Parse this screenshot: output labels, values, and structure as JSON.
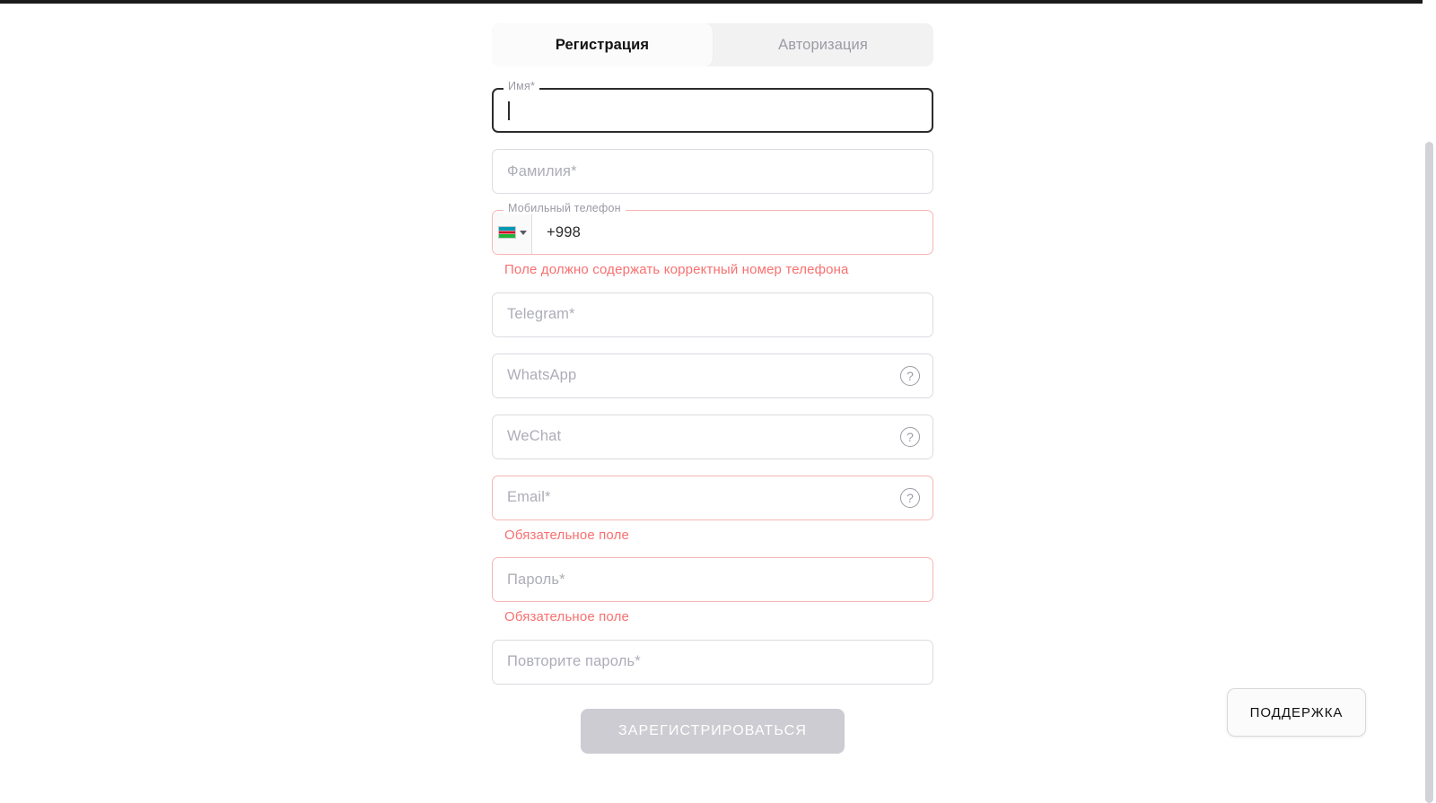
{
  "colors": {
    "error": "#f97070",
    "error_border": "#f7b5b5",
    "border": "#dcdce2",
    "placeholder": "#adadb8",
    "tab_bg": "#f2f2f3",
    "submit_disabled": "#ccccd2",
    "text": "#121212"
  },
  "tabs": [
    {
      "label": "Регистрация",
      "active": true
    },
    {
      "label": "Авторизация",
      "active": false
    }
  ],
  "form": {
    "first_name": {
      "label": "Имя*",
      "value": "",
      "focused": true
    },
    "last_name": {
      "placeholder": "Фамилия*",
      "value": ""
    },
    "phone": {
      "label": "Мобильный телефон",
      "value": "+998",
      "country": "Uzbekistan",
      "error": "Поле должно содержать корректный номер телефона"
    },
    "telegram": {
      "placeholder": "Telegram*",
      "value": ""
    },
    "whatsapp": {
      "placeholder": "WhatsApp",
      "value": "",
      "help": "?"
    },
    "wechat": {
      "placeholder": "WeChat",
      "value": "",
      "help": "?"
    },
    "email": {
      "placeholder": "Email*",
      "value": "",
      "help": "?",
      "error": "Обязательное поле"
    },
    "password": {
      "placeholder": "Пароль*",
      "value": "",
      "error": "Обязательное поле"
    },
    "password_repeat": {
      "placeholder": "Повторите пароль*",
      "value": ""
    },
    "submit_label": "ЗАРЕГИСТРИРОВАТЬСЯ"
  },
  "support": {
    "label": "ПОДДЕРЖКА"
  }
}
